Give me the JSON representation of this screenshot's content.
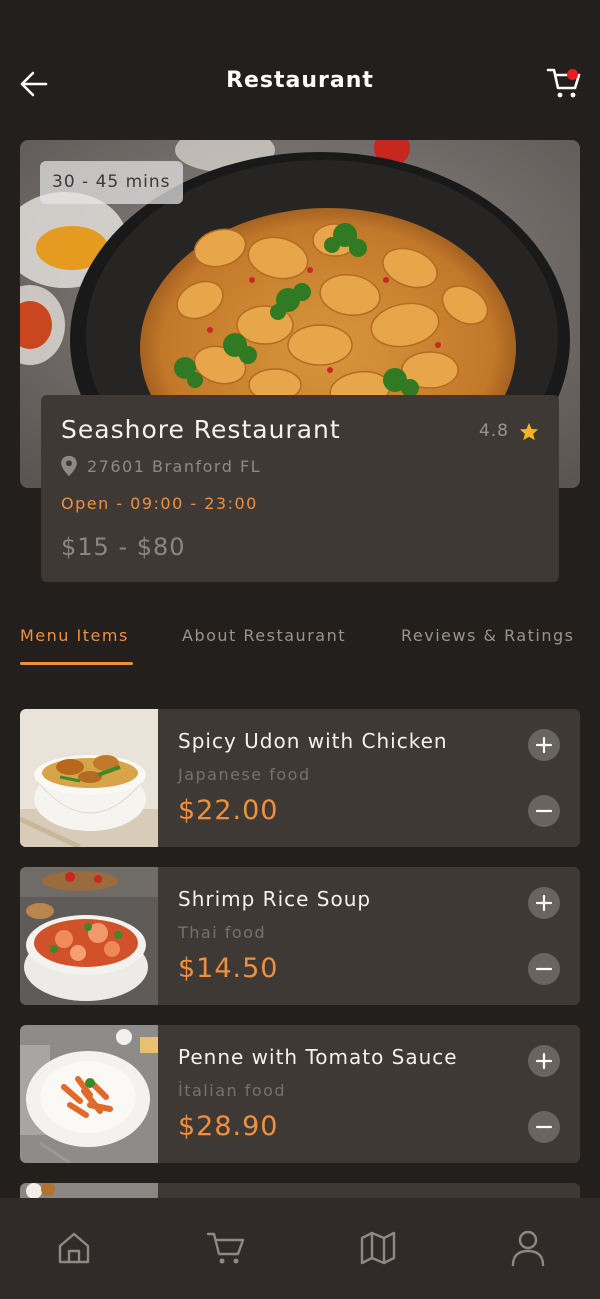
{
  "header": {
    "title": "Restaurant",
    "back_icon": "arrow-left-icon",
    "cart_icon": "cart-icon",
    "cart_badge_color": "#e81c1c"
  },
  "hero": {
    "delivery_time": "30 - 45 mins"
  },
  "restaurant": {
    "name": "Seashore Restaurant",
    "rating": "4.8",
    "address": "27601 Branford FL",
    "hours": "Open - 09:00 - 23:00",
    "price_range": "$15 - $80"
  },
  "tabs": [
    {
      "label": "Menu Items",
      "active": true
    },
    {
      "label": "About Restaurant",
      "active": false
    },
    {
      "label": "Reviews & Ratings",
      "active": false
    }
  ],
  "menu": [
    {
      "name": "Spicy Udon with Chicken",
      "category": "Japanese food",
      "price": "$22.00"
    },
    {
      "name": "Shrimp Rice Soup",
      "category": "Thai food",
      "price": "$14.50"
    },
    {
      "name": "Penne with Tomato Sauce",
      "category": "İtalian food",
      "price": "$28.90"
    }
  ],
  "bottom_nav": [
    {
      "icon": "home-icon"
    },
    {
      "icon": "cart-icon"
    },
    {
      "icon": "map-icon"
    },
    {
      "icon": "user-icon"
    }
  ],
  "colors": {
    "background": "#221f1d",
    "card": "#3f3935",
    "accent": "#f0903e",
    "star": "#f5b51e"
  }
}
